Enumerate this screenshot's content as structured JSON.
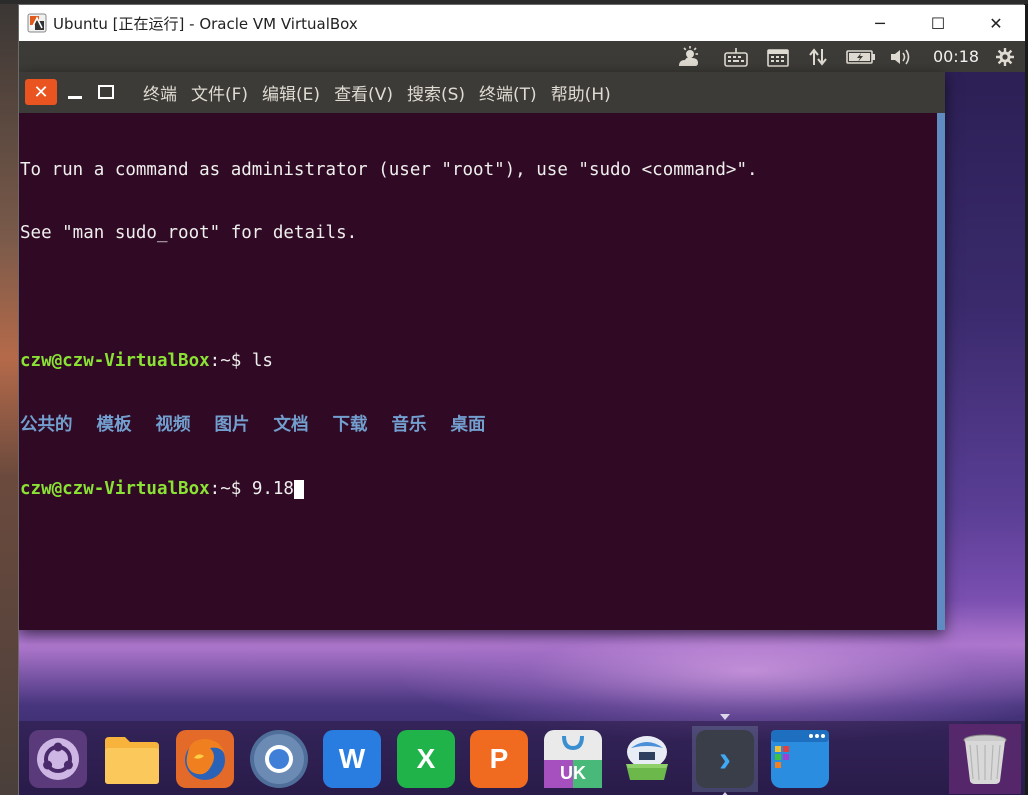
{
  "vbox": {
    "title": "Ubuntu [正在运行] - Oracle VM VirtualBox",
    "controls": {
      "minimize": "─",
      "maximize": "☐",
      "close": "✕"
    }
  },
  "panel": {
    "clock": "00:18",
    "icons": [
      "weather-icon",
      "keyboard-icon",
      "calendar-icon",
      "network-icon",
      "battery-icon",
      "volume-icon",
      "settings-gear-icon"
    ]
  },
  "terminal": {
    "controls": {
      "close": "✕"
    },
    "menu": {
      "title": "终端",
      "items": [
        "文件(F)",
        "编辑(E)",
        "查看(V)",
        "搜索(S)",
        "终端(T)",
        "帮助(H)"
      ]
    },
    "lines": {
      "motd1": "To run a command as administrator (user \"root\"), use \"sudo <command>\".",
      "motd2": "See \"man sudo_root\" for details.",
      "prompt1_user": "czw@czw-VirtualBox",
      "prompt1_sep": ":~$ ",
      "prompt1_cmd": "ls",
      "ls_output": [
        "公共的",
        "模板",
        "视频",
        "图片",
        "文档",
        "下载",
        "音乐",
        "桌面"
      ],
      "prompt2_user": "czw@czw-VirtualBox",
      "prompt2_sep": ":~$ ",
      "prompt2_cmd": "9.18"
    },
    "colors": {
      "background": "#300a24",
      "prompt": "#8ae234",
      "directory": "#729fcf",
      "text": "#eeeeec"
    }
  },
  "dock": {
    "items": [
      {
        "name": "ubuntu-logo",
        "label": ""
      },
      {
        "name": "files",
        "label": ""
      },
      {
        "name": "firefox",
        "label": ""
      },
      {
        "name": "chromium",
        "label": ""
      },
      {
        "name": "wps-writer",
        "label": "W"
      },
      {
        "name": "wps-spreadsheets",
        "label": "X"
      },
      {
        "name": "wps-presentation",
        "label": "P"
      },
      {
        "name": "ubuntu-kylin-store",
        "label": "UK"
      },
      {
        "name": "software-updater",
        "label": ""
      },
      {
        "name": "terminal",
        "label": "›"
      },
      {
        "name": "workspace-switcher",
        "label": ""
      },
      {
        "name": "trash",
        "label": ""
      }
    ]
  }
}
